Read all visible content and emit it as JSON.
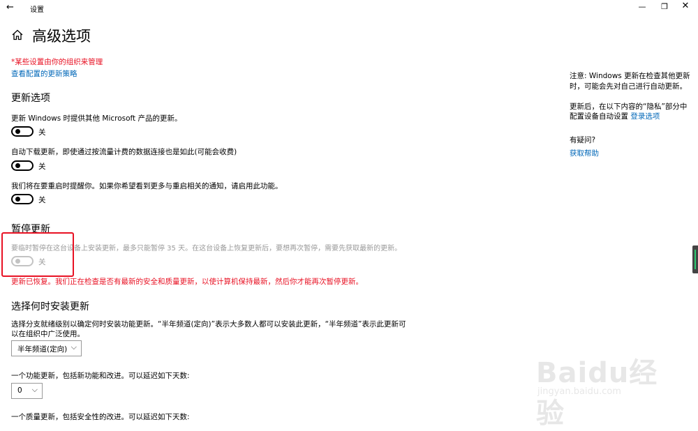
{
  "window": {
    "back_glyph": "←",
    "app_title": "设置",
    "minimize_glyph": "—",
    "maximize_glyph": "❐",
    "close_glyph": "✕"
  },
  "page": {
    "title": "高级选项"
  },
  "managed": {
    "notice": "*某些设置由你的组织来管理",
    "policy_link": "查看配置的更新策略"
  },
  "update_options": {
    "heading": "更新选项",
    "items": [
      {
        "label": "更新 Windows 时提供其他 Microsoft 产品的更新。",
        "state": "关"
      },
      {
        "label": "自动下载更新，即使通过按流量计费的数据连接也是如此(可能会收费)",
        "state": "关"
      },
      {
        "label": "我们将在要重启时提醒你。如果你希望看到更多与重启相关的通知，请启用此功能。",
        "state": "关"
      }
    ]
  },
  "pause": {
    "heading": "暂停更新",
    "desc": "要临时暂停在这台设备上安装更新，最多只能暂停 35 天。在这台设备上恢复更新后，要想再次暂停，需要先获取最新的更新。",
    "state": "关",
    "warning": "更新已恢复。我们正在检查是否有最新的安全和质量更新，以使计算机保持最新，然后你才能再次暂停更新。"
  },
  "choose_install": {
    "heading": "选择何时安装更新",
    "desc_line1": "选择分支就绪级别以确定何时安装功能更新。“半年频道(定向)”表示大多数人都可以安装此更新，“半年频道”表示此更新可",
    "desc_line2": "以在组织中广泛使用。",
    "channel_value": "半年频道(定向)",
    "feature_desc": "一个功能更新，包括新功能和改进。可以延迟如下天数:",
    "feature_days": "0",
    "quality_desc_partial": "一个质量更新，包括安全性的改进。可以延迟如下天数:"
  },
  "sidebar": {
    "note_line1": "注意: Windows 更新在检查其他更新",
    "note_line2": "时，可能会先对自己进行自动更新。",
    "privacy_line1": "更新后，在以下内容的“隐私”部分中",
    "privacy_line2": "配置设备自动设置",
    "privacy_link": "登录选项",
    "question": "有疑问?",
    "help_link": "获取帮助"
  },
  "watermark": {
    "brand": "Baidu经验",
    "url": "jingyan.baidu.com"
  },
  "colors": {
    "warning_red": "#e81123",
    "link_blue": "#0067b8",
    "disabled_gray": "#9a9a9a"
  }
}
